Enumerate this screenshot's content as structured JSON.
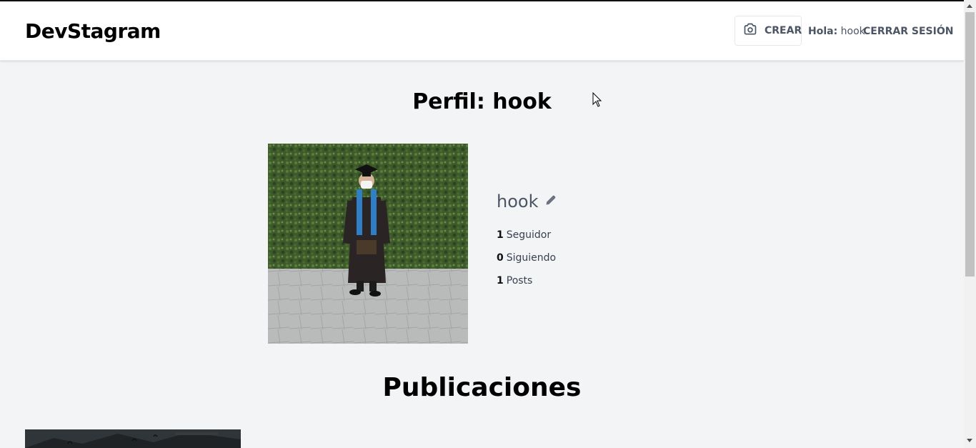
{
  "header": {
    "logo": "DevStagram",
    "create_label": "CREAR",
    "greeting_prefix": "Hola:",
    "greeting_user": "hook",
    "logout_label": "CERRAR SESIÓN"
  },
  "profile": {
    "title": "Perfil: hook",
    "username": "hook",
    "stats": [
      {
        "value": "1",
        "label": "Seguidor"
      },
      {
        "value": "0",
        "label": "Siguiendo"
      },
      {
        "value": "1",
        "label": "Posts"
      }
    ]
  },
  "publications": {
    "title": "Publicaciones"
  },
  "colors": {
    "background": "#f3f4f6",
    "header_bg": "#ffffff",
    "text_muted": "#4b5563"
  },
  "icons": {
    "create": "camera-icon",
    "edit": "pencil-icon"
  }
}
